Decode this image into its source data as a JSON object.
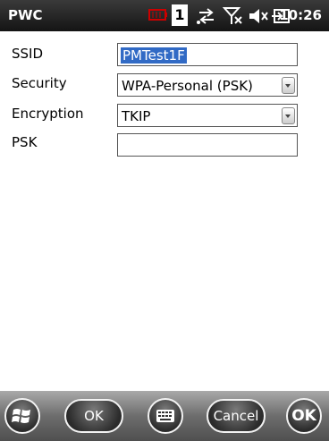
{
  "status_bar": {
    "app_title": "PWC",
    "time": "10:26",
    "notification_count": "1",
    "icons": [
      "battery-icon",
      "notification-count-icon",
      "connectivity-icon",
      "no-signal-icon",
      "volume-mute-icon",
      "power-connected-icon"
    ]
  },
  "form": {
    "ssid_label": "SSID",
    "ssid_value": "PMTest1F",
    "security_label": "Security",
    "security_value": "WPA-Personal (PSK)",
    "encryption_label": "Encryption",
    "encryption_value": "TKIP",
    "psk_label": "PSK",
    "psk_value": ""
  },
  "softbar": {
    "ok_label": "OK",
    "cancel_label": "Cancel",
    "ok_round_label": "OK"
  }
}
